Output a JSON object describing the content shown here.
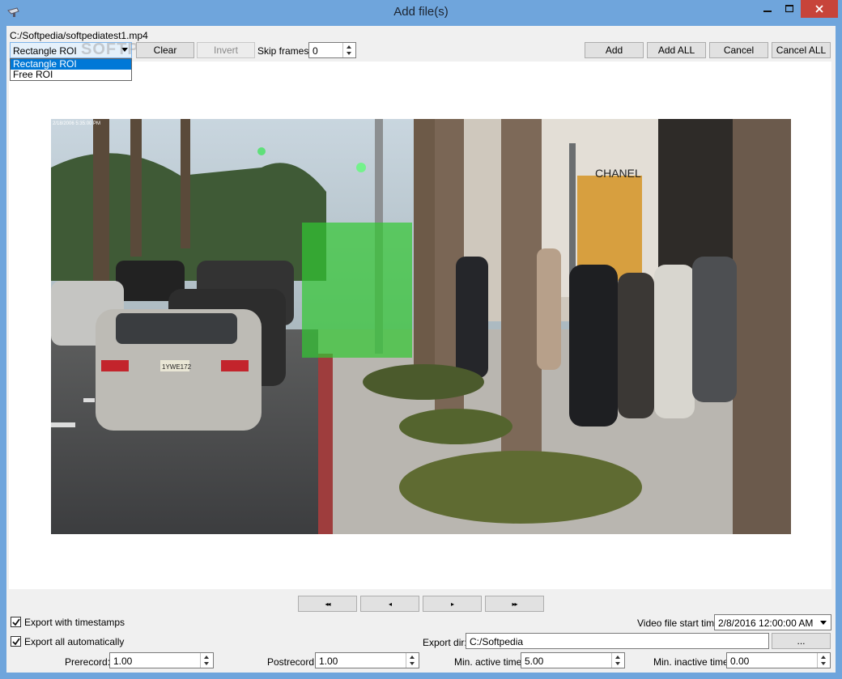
{
  "window": {
    "title": "Add file(s)"
  },
  "file": {
    "path": "C:/Softpedia/softpediatest1.mp4"
  },
  "roi": {
    "selected": "Rectangle ROI",
    "options": [
      "Rectangle ROI",
      "Free ROI"
    ],
    "watermark": "SOFTPEDIA"
  },
  "toolbar": {
    "clear_label": "Clear",
    "invert_label": "Invert",
    "skip_frames_label": "Skip frames:",
    "skip_frames_value": "0",
    "add_label": "Add",
    "add_all_label": "Add ALL",
    "cancel_label": "Cancel",
    "cancel_all_label": "Cancel ALL"
  },
  "video": {
    "timestamp": "2/18/2006 5:35:00 PM",
    "sign_text": "CHANEL",
    "plate_text": "1YWE172",
    "roi_color": "#32c832"
  },
  "navigation": {
    "first": "◂◂",
    "prev": "◂",
    "next": "▸",
    "last": "▸▸"
  },
  "options": {
    "export_timestamps_label": "Export with timestamps",
    "export_timestamps_checked": true,
    "export_auto_label": "Export all automatically",
    "export_auto_checked": true,
    "video_start_label": "Video file start time",
    "video_start_value": "2/8/2016 12:00:00 AM",
    "export_dir_label": "Export dir:",
    "export_dir_value": "C:/Softpedia",
    "browse_label": "..."
  },
  "timing": {
    "prerecord_label": "Prerecord:",
    "prerecord_value": "1.00",
    "postrecord_label": "Postrecord:",
    "postrecord_value": "1.00",
    "min_active_label": "Min. active time:",
    "min_active_value": "5.00",
    "min_inactive_label": "Min. inactive time:",
    "min_inactive_value": "0.00"
  }
}
